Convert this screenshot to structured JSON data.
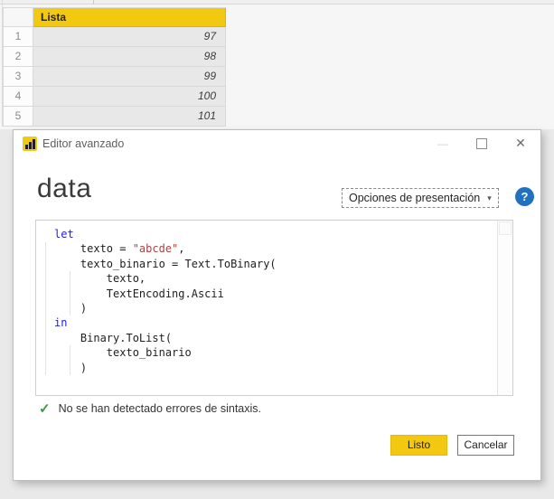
{
  "table": {
    "header": "Lista",
    "rows": [
      {
        "num": "1",
        "value": "97"
      },
      {
        "num": "2",
        "value": "98"
      },
      {
        "num": "3",
        "value": "99"
      },
      {
        "num": "4",
        "value": "100"
      },
      {
        "num": "5",
        "value": "101"
      }
    ]
  },
  "dialog": {
    "title": "Editor avanzado",
    "heading": "data",
    "display_options_label": "Opciones de presentación",
    "dropdown_caret": "▾",
    "help_label": "?",
    "window_controls": {
      "minimize": "—",
      "close": "✕"
    },
    "code_lines": [
      [
        [
          "let",
          "k"
        ]
      ],
      [
        [
          "    texto = ",
          "p"
        ],
        [
          "\"abcde\"",
          "s"
        ],
        [
          ",",
          "p"
        ]
      ],
      [
        [
          "    texto_binario = Text.ToBinary(",
          "p"
        ]
      ],
      [
        [
          "        texto,",
          "p"
        ]
      ],
      [
        [
          "        TextEncoding.Ascii",
          "p"
        ]
      ],
      [
        [
          "    )",
          "p"
        ]
      ],
      [
        [
          "in",
          "k"
        ]
      ],
      [
        [
          "    Binary.ToList(",
          "p"
        ]
      ],
      [
        [
          "        texto_binario",
          "p"
        ]
      ],
      [
        [
          "    )",
          "p"
        ]
      ]
    ],
    "status_icon": "✓",
    "status_text": "No se han detectado errores de sintaxis.",
    "ok_label": "Listo",
    "cancel_label": "Cancelar"
  },
  "colors": {
    "accent_yellow": "#F2C811",
    "keyword_blue": "#2323D7",
    "string_red": "#A94442",
    "success_green": "#3C9B3C",
    "help_blue": "#2172BE"
  }
}
